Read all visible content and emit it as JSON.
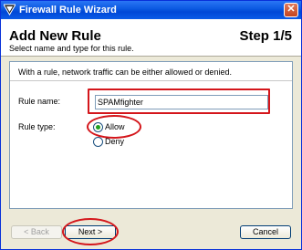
{
  "window": {
    "title": "Firewall Rule Wizard",
    "close_glyph": "✕"
  },
  "header": {
    "title": "Add New Rule",
    "subtitle": "Select name and type for this rule.",
    "step": "Step 1/5"
  },
  "panel": {
    "intro": "With a rule, network traffic can be either allowed or denied."
  },
  "form": {
    "rule_name_label": "Rule name:",
    "rule_name_value": "SPAMfighter",
    "rule_type_label": "Rule type:",
    "rule_type_options": [
      {
        "label": "Allow",
        "selected": true
      },
      {
        "label": "Deny",
        "selected": false
      }
    ]
  },
  "buttons": {
    "back": "< Back",
    "next": "Next >",
    "cancel": "Cancel"
  },
  "icons": {
    "app": "firewall-wizard-icon",
    "close": "close-icon"
  },
  "colors": {
    "titlebar": "#0a58e0",
    "highlight": "#d4161b",
    "radio_dot": "#21a121"
  }
}
